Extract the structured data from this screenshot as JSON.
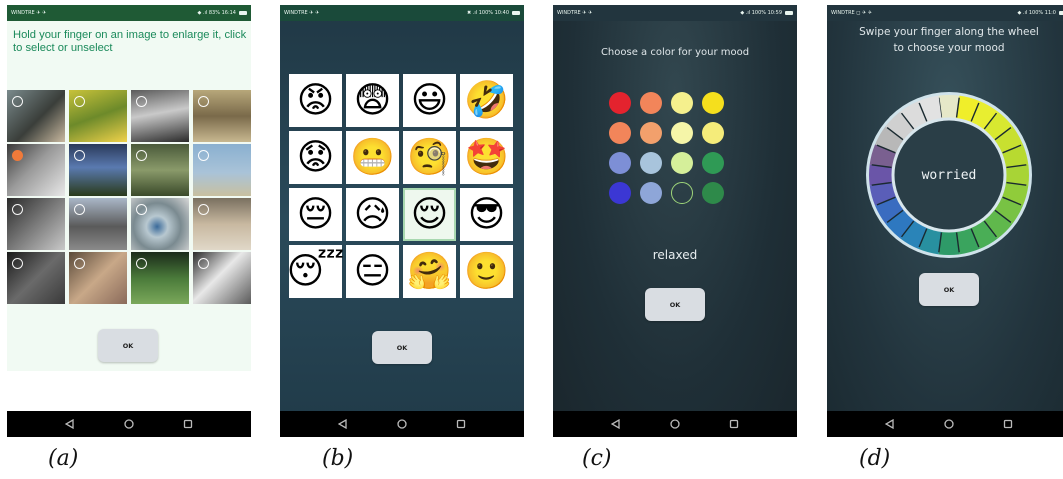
{
  "captions": [
    "(a)",
    "(b)",
    "(c)",
    "(d)"
  ],
  "phones": {
    "a": {
      "status": {
        "carrier": "WINDTRE ✈ ✈",
        "right": "◆ .ıl 83%  16:14"
      },
      "instruction": "Hold your finger on an image to enlarge it, click to select or unselect",
      "ok_label": "OK"
    },
    "b": {
      "status": {
        "carrier": "WINDTRE ✈ ✈",
        "right": "✖ .ıl 100%  10:40"
      },
      "emojis": [
        "😡",
        "😨",
        "😃",
        "🤣",
        "😟",
        "😬",
        "🧐",
        "🤩",
        "😔",
        "😥",
        "😌",
        "😎",
        "😴",
        "😑",
        "🤗",
        "🙂"
      ],
      "selected_index": 10,
      "ok_label": "OK"
    },
    "c": {
      "status": {
        "carrier": "WINDTRE ✈ ✈",
        "right": "◆ .ıl 100%  10:59"
      },
      "prompt": "Choose a color for your mood",
      "colors": [
        "#e4232e",
        "#f2855a",
        "#f5f08d",
        "#f5df1d",
        "#f2855a",
        "#f2a06c",
        "#f5f5a8",
        "#f5ec7a",
        "#7d8fd6",
        "#a8c4dc",
        "#d5ef9a",
        "#2f9a55",
        "#3b37d4",
        "#8ea6d8",
        "#ffffff",
        "#2e8a4a"
      ],
      "selected_index": 14,
      "mood_label": "relaxed",
      "ok_label": "OK"
    },
    "d": {
      "status": {
        "carrier": "WINDTRE ◻ ✈ ✈",
        "right": "◆ .ıl 100%  11:0"
      },
      "prompt_line1": "Swipe your finger along the wheel",
      "prompt_line2": "to choose your mood",
      "wheel_center_label": "worried",
      "ok_label": "OK"
    }
  },
  "icons": {
    "back": "back-triangle-icon",
    "home": "home-circle-icon",
    "recents": "recents-square-icon"
  }
}
